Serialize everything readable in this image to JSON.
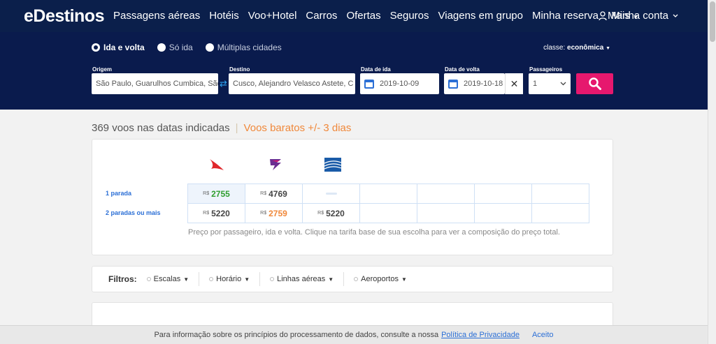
{
  "nav": {
    "logo": "eDestinos",
    "links": [
      "Passagens aéreas",
      "Hotéis",
      "Voo+Hotel",
      "Carros",
      "Ofertas",
      "Seguros",
      "Viagens em grupo",
      "Minha reserva"
    ],
    "more": "Mais",
    "account": "Minha conta"
  },
  "search": {
    "trip_types": [
      "Ida e volta",
      "Só ida",
      "Múltiplas cidades"
    ],
    "classe_label": "classe:",
    "classe_value": "econômica",
    "origin_label": "Origem",
    "origin_value": "São Paulo, Guarulhos Cumbica, São",
    "destination_label": "Destino",
    "destination_value": "Cusco, Alejandro Velasco Astete, C",
    "depart_label": "Data de ida",
    "depart_value": "2019-10-09",
    "return_label": "Data de volta",
    "return_value": "2019-10-18",
    "passengers_label": "Passageiros",
    "passengers_value": "1"
  },
  "results": {
    "count_text": "369 voos nas datas indicadas",
    "separator": "|",
    "cheap_text": "Voos baratos +/- 3 dias"
  },
  "matrix": {
    "currency": "R$",
    "rows": [
      {
        "label": "1 parada",
        "cells": [
          {
            "value": "2755",
            "style": "green"
          },
          {
            "value": "4769",
            "style": "normal"
          },
          {
            "value": "",
            "style": "dash"
          }
        ]
      },
      {
        "label": "2 paradas ou mais",
        "cells": [
          {
            "value": "5220",
            "style": "normal"
          },
          {
            "value": "2759",
            "style": "orange"
          },
          {
            "value": "5220",
            "style": "normal"
          }
        ]
      }
    ],
    "note": "Preço por passageiro, ida e volta. Clique na tarifa base de sua escolha para ver a composição do preço total."
  },
  "filters": {
    "title": "Filtros:",
    "items": [
      "Escalas",
      "Horário",
      "Linhas aéreas",
      "Aeroportos"
    ]
  },
  "cookie": {
    "text": "Para informação sobre os princípios do processamento de dados, consulte a nossa",
    "link": "Política de Privacidade",
    "accept": "Aceito"
  },
  "colors": {
    "nav_bg": "#0b1f4b",
    "search_bg": "#0a1b4d",
    "search_button": "#e6186e",
    "price_green": "#2f9e2f",
    "price_orange": "#f0883a",
    "link_blue": "#2b6fd6"
  }
}
